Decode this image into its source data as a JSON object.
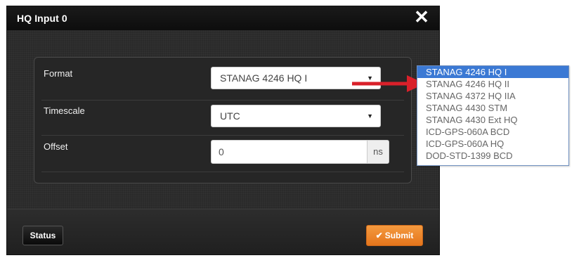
{
  "dialog": {
    "title": "HQ Input 0",
    "close_icon": "close-icon"
  },
  "form": {
    "format": {
      "label": "Format",
      "selected": "STANAG 4246 HQ I"
    },
    "timescale": {
      "label": "Timescale",
      "selected": "UTC"
    },
    "offset": {
      "label": "Offset",
      "value": "0",
      "unit": "ns"
    }
  },
  "footer": {
    "status_label": "Status",
    "submit_label": "Submit",
    "submit_icon": "check-icon"
  },
  "format_dropdown": {
    "options": [
      "STANAG 4246 HQ I",
      "STANAG 4246 HQ II",
      "STANAG 4372 HQ IIA",
      "STANAG 4430 STM",
      "STANAG 4430 Ext HQ",
      "ICD-GPS-060A BCD",
      "ICD-GPS-060A HQ",
      "DOD-STD-1399 BCD"
    ],
    "highlighted_index": 0
  },
  "colors": {
    "dialog_background": "#222222",
    "submit_orange": "#ee8a2e",
    "dropdown_highlight": "#3b79d4",
    "annotation_arrow": "#d9202a"
  }
}
